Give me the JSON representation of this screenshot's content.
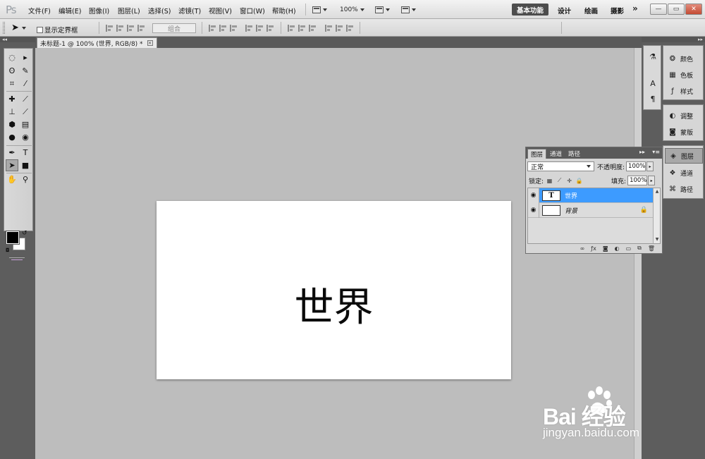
{
  "app": {
    "logo": "Ps"
  },
  "menu": [
    "文件(F)",
    "编辑(E)",
    "图像(I)",
    "图层(L)",
    "选择(S)",
    "滤镜(T)",
    "视图(V)",
    "窗口(W)",
    "帮助(H)"
  ],
  "menubar_controls": {
    "zoom": "100%"
  },
  "workspaces": {
    "active": "基本功能",
    "items": [
      "设计",
      "绘画",
      "摄影"
    ],
    "more": "»"
  },
  "window_buttons": {
    "minimize": "—",
    "restore": "▭",
    "close": "✕"
  },
  "options": {
    "show_bounds": "显示定界框",
    "combine": "组合"
  },
  "document_tab": {
    "title": "未标题-1 @ 100% (世界, RGB/8) *",
    "close": "×"
  },
  "document": {
    "text": "世界"
  },
  "right_panels": {
    "group1": [
      "颜色",
      "色板",
      "样式"
    ],
    "group2": [
      "调整",
      "蒙版"
    ],
    "group3": [
      "图层",
      "通道",
      "路径"
    ]
  },
  "layers_panel": {
    "tabs": [
      "图层",
      "通道",
      "路径"
    ],
    "blend_mode": "正常",
    "opacity_label": "不透明度:",
    "opacity": "100%",
    "lock_label": "锁定:",
    "fill_label": "填充:",
    "fill": "100%",
    "layers": [
      {
        "name": "世界",
        "thumb": "T",
        "selected": true,
        "italic": false
      },
      {
        "name": "背景",
        "thumb": "",
        "selected": false,
        "italic": true
      }
    ]
  },
  "watermark": {
    "brand": "Bai  经验",
    "url": "jingyan.baidu.com"
  },
  "colors": {
    "selection": "#3d9bff",
    "workspace_active": "#4d4d4d",
    "canvas_bg": "#bdbdbd"
  }
}
